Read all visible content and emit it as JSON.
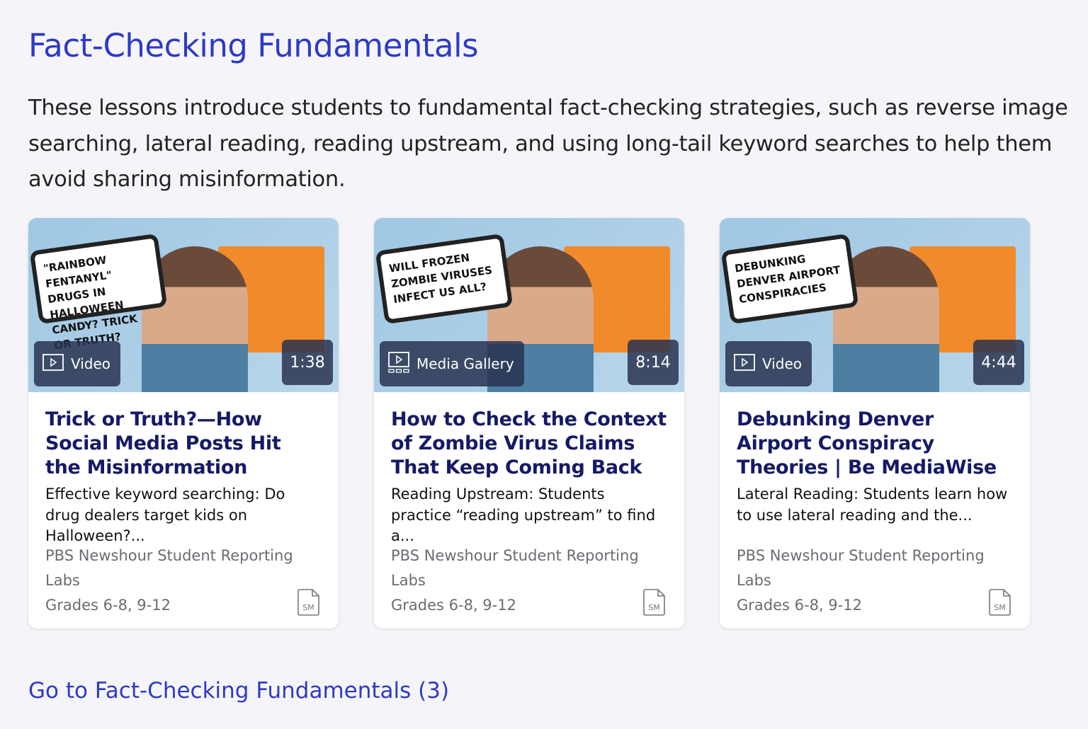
{
  "section": {
    "title": "Fact-Checking Fundamentals",
    "description": "These lessons introduce students to fundamental fact-checking strategies, such as reverse image searching, lateral reading, reading upstream, and using long-tail keyword searches to help them avoid sharing misinformation.",
    "go_link": "Go to Fact-Checking Fundamentals (3)"
  },
  "colors": {
    "accent": "#2e3ac6",
    "card_title": "#151a66",
    "meta": "#6b6b72",
    "background": "#f5f5f9"
  },
  "cards": [
    {
      "type": "Video",
      "type_icon": "play-icon",
      "duration": "1:38",
      "thumb_text": "\"RAINBOW FENTANYL\" DRUGS IN HALLOWEEN CANDY? TRICK OR TRUTH?",
      "title": "Trick or Truth?—How Social Media Posts Hit the Misinformation Sweet...",
      "summary": "Effective keyword searching: Do drug dealers target kids on Halloween?...",
      "publisher": "PBS Newshour Student Reporting Labs",
      "grades": "Grades 6-8, 9-12",
      "file_icon": "SM"
    },
    {
      "type": "Media Gallery",
      "type_icon": "media-gallery-icon",
      "duration": "8:14",
      "thumb_text": "WILL FROZEN ZOMBIE VIRUSES INFECT US ALL?",
      "title": "How to Check the Context of Zombie Virus Claims That Keep Coming Back t...",
      "summary": "Reading Upstream: Students practice “reading upstream” to find a...",
      "publisher": "PBS Newshour Student Reporting Labs",
      "grades": "Grades 6-8, 9-12",
      "file_icon": "SM"
    },
    {
      "type": "Video",
      "type_icon": "play-icon",
      "duration": "4:44",
      "thumb_text": "DEBUNKING DENVER AIRPORT CONSPIRACIES",
      "title": "Debunking Denver Airport Conspiracy Theories | Be MediaWise",
      "summary": "Lateral Reading: Students learn how to use lateral reading and the...",
      "publisher": "PBS Newshour Student Reporting Labs",
      "grades": "Grades 6-8, 9-12",
      "file_icon": "SM"
    }
  ]
}
